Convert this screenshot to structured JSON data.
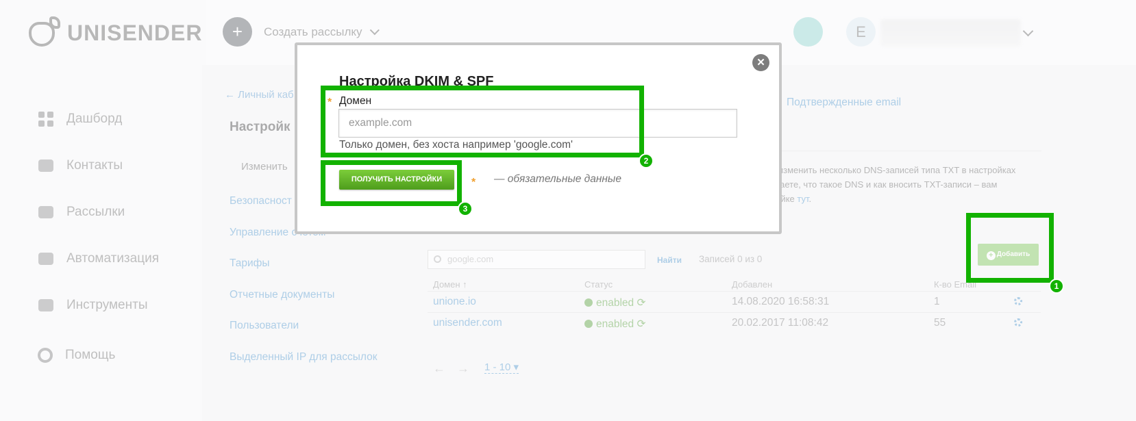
{
  "brand": {
    "name": "UNISENDER"
  },
  "sidebar": {
    "items": [
      {
        "label": "Дашборд",
        "icon": "dashboard-icon"
      },
      {
        "label": "Контакты",
        "icon": "contacts-icon"
      },
      {
        "label": "Рассылки",
        "icon": "mailings-icon"
      },
      {
        "label": "Автоматизация",
        "icon": "automation-icon"
      },
      {
        "label": "Инструменты",
        "icon": "magic-wand-icon"
      }
    ],
    "help": "Помощь"
  },
  "topbar": {
    "create_label": "Создать рассылку",
    "avatar_letter": "E"
  },
  "page": {
    "back_link": "← Личный каб",
    "heading": "Настройк",
    "change_tab": "Изменить",
    "confirmed_email": "Подтвержденные email",
    "description_1": "о изменить несколько DNS-записей типа TXT в настройках",
    "description_2": "знаете, что такое DNS и как вносить TXT-записи – вам",
    "description_3": "ройке",
    "description_link": "тут",
    "links": [
      "Безопасност",
      "Управление счетом",
      "Тарифы",
      "Отчетные документы",
      "Пользователи",
      "Выделенный IP для рассылок"
    ]
  },
  "table": {
    "search_placeholder": "google.com",
    "find_label": "Найти",
    "records_label": "Записей 0 из 0",
    "add_label": "Добавить",
    "columns": [
      "Домен ↑",
      "Статус",
      "Добавлен",
      "К-во Email"
    ],
    "rows": [
      {
        "domain": "unione.io",
        "status": "enabled",
        "added": "14.08.2020 16:58:31",
        "count": "1"
      },
      {
        "domain": "unisender.com",
        "status": "enabled",
        "added": "20.02.2017 11:08:42",
        "count": "55"
      }
    ],
    "pager": "1 - 10 ▾"
  },
  "modal": {
    "title": "Настройка DKIM & SPF",
    "field_label": "Домен",
    "input_placeholder": "example.com",
    "hint": "Только домен, без хоста например 'google.com'",
    "button_label": "ПОЛУЧИТЬ НАСТРОЙКИ",
    "required_note": "— обязательные данные",
    "close_symbol": "✕"
  },
  "annotations": [
    "1",
    "2",
    "3"
  ],
  "colors": {
    "highlight": "#12b200",
    "accent_green": "#6fc046",
    "link": "#3c8cc9"
  }
}
